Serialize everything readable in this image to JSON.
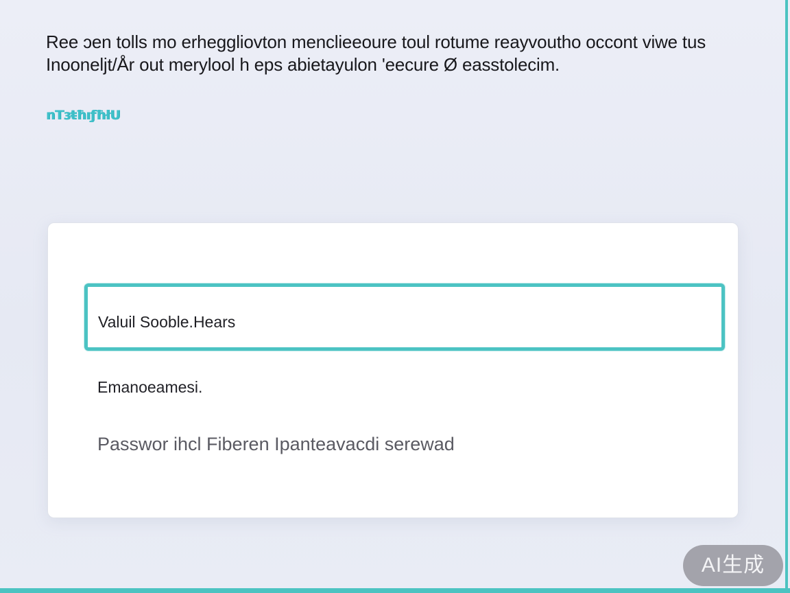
{
  "intro": {
    "line1": "Ree ɔen tolls mo erheggliovton menclieeoure toul rotume reayvoutho occont viwe tus",
    "line2": "Inooneljt/År out merylool h eps abietayulon 'eecure Ø easstolecim."
  },
  "brand": {
    "label": "nTɜŧħıƒħłU"
  },
  "form": {
    "username_value": "Valuil Sooble.Hears",
    "email_value": "Emanoeamesi.",
    "password_value": "Passwor ihcl Fiberen Ipanteavacdi serewad"
  },
  "badge": {
    "label": "AI生成"
  },
  "colors": {
    "accent": "#4cc3c3",
    "background": "#e8ebf4",
    "card": "#ffffff"
  }
}
